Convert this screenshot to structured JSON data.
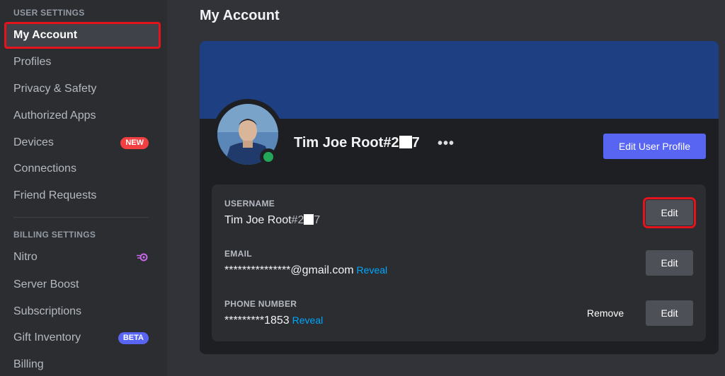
{
  "sidebar": {
    "user_settings_header": "USER SETTINGS",
    "user_items": [
      {
        "label": "My Account"
      },
      {
        "label": "Profiles"
      },
      {
        "label": "Privacy & Safety"
      },
      {
        "label": "Authorized Apps"
      },
      {
        "label": "Devices",
        "badge": "NEW"
      },
      {
        "label": "Connections"
      },
      {
        "label": "Friend Requests"
      }
    ],
    "billing_settings_header": "BILLING SETTINGS",
    "billing_items": [
      {
        "label": "Nitro"
      },
      {
        "label": "Server Boost"
      },
      {
        "label": "Subscriptions"
      },
      {
        "label": "Gift Inventory",
        "badge": "BETA"
      },
      {
        "label": "Billing"
      }
    ]
  },
  "main": {
    "title": "My Account",
    "profile": {
      "name_prefix": "Tim Joe Root",
      "discriminator_start": "#2",
      "discriminator_end": "7",
      "more_label": "•••",
      "edit_profile_label": "Edit User Profile",
      "status": "online",
      "banner_color": "#1e3f82"
    },
    "fields": {
      "username": {
        "label": "USERNAME",
        "value_prefix": "Tim Joe Root",
        "discriminator_start": "#2",
        "discriminator_end": "7",
        "edit_label": "Edit"
      },
      "email": {
        "label": "EMAIL",
        "value": "***************@gmail.com",
        "reveal_label": "Reveal",
        "edit_label": "Edit"
      },
      "phone": {
        "label": "PHONE NUMBER",
        "value": "*********1853",
        "reveal_label": "Reveal",
        "remove_label": "Remove",
        "edit_label": "Edit"
      }
    }
  },
  "colors": {
    "accent": "#5865f2",
    "highlight": "#e5131b",
    "link": "#00a8fc",
    "online": "#23a55a"
  }
}
